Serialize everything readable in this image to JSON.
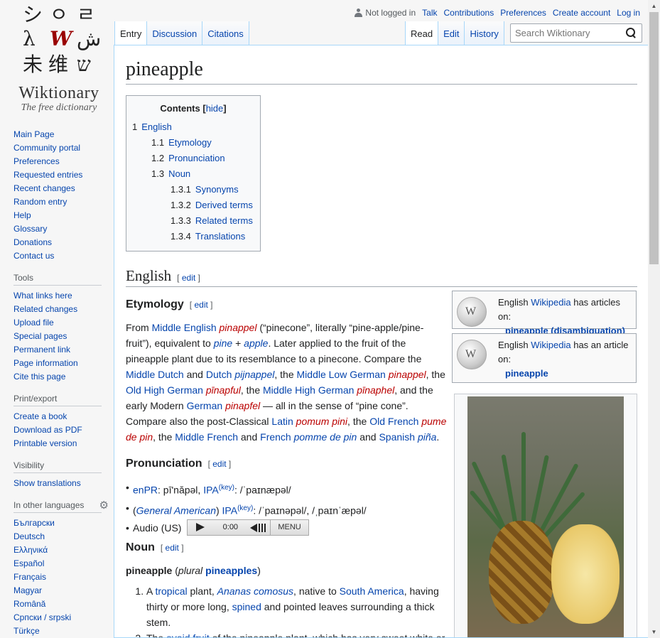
{
  "logo": {
    "glyphs": [
      "シ",
      "ㅇ",
      "ㄹ",
      "λ",
      "W",
      "ش",
      "未",
      "维",
      "ש"
    ],
    "wordmark": "Wiktionary",
    "tagline": "The free dictionary"
  },
  "sidebar": {
    "nav": [
      "Main Page",
      "Community portal",
      "Preferences",
      "Requested entries",
      "Recent changes",
      "Random entry",
      "Help",
      "Glossary",
      "Donations",
      "Contact us"
    ],
    "tools_title": "Tools",
    "tools": [
      "What links here",
      "Related changes",
      "Upload file",
      "Special pages",
      "Permanent link",
      "Page information",
      "Cite this page"
    ],
    "print_title": "Print/export",
    "print": [
      "Create a book",
      "Download as PDF",
      "Printable version"
    ],
    "visibility_title": "Visibility",
    "visibility": [
      "Show translations"
    ],
    "languages_title": "In other languages",
    "languages": [
      "Български",
      "Deutsch",
      "Ελληνικά",
      "Español",
      "Français",
      "Magyar",
      "Română",
      "Српски / srpski",
      "Türkçe"
    ]
  },
  "personal": {
    "not_logged_in": "Not logged in",
    "links": [
      "Talk",
      "Contributions",
      "Preferences",
      "Create account",
      "Log in"
    ]
  },
  "tabs_left": [
    "Entry",
    "Discussion",
    "Citations"
  ],
  "tabs_right": [
    "Read",
    "Edit",
    "History"
  ],
  "search": {
    "placeholder": "Search Wiktionary"
  },
  "page": {
    "title": "pineapple",
    "toc": {
      "title": "Contents",
      "hide": "hide",
      "items": [
        {
          "num": "1",
          "label": "English",
          "level": 1
        },
        {
          "num": "1.1",
          "label": "Etymology",
          "level": 2
        },
        {
          "num": "1.2",
          "label": "Pronunciation",
          "level": 2
        },
        {
          "num": "1.3",
          "label": "Noun",
          "level": 2
        },
        {
          "num": "1.3.1",
          "label": "Synonyms",
          "level": 3
        },
        {
          "num": "1.3.2",
          "label": "Derived terms",
          "level": 3
        },
        {
          "num": "1.3.3",
          "label": "Related terms",
          "level": 3
        },
        {
          "num": "1.3.4",
          "label": "Translations",
          "level": 3
        }
      ]
    },
    "lang_heading": "English",
    "edit": "edit",
    "etymology_heading": "Etymology",
    "pronunciation_heading": "Pronunciation",
    "noun_heading": "Noun",
    "wp1": {
      "prefix": "English ",
      "link": "Wikipedia",
      "suffix": " has articles on:",
      "target": "pineapple (disambiguation)"
    },
    "wp2": {
      "prefix": "English ",
      "link": "Wikipedia",
      "suffix": " has an article on:",
      "target": "pineapple"
    },
    "pron": {
      "enpr_label": "enPR",
      "enpr_value": ": pīʹnăpəl, ",
      "ipa": "IPA",
      "key": "(key)",
      "ipa1": ": /ˈpaɪnæpəl/",
      "ga": "General American",
      "ipa2": ": /ˈpaɪnəpəl/, /ˌpaɪnˈæpəl/",
      "audio_label": "Audio (US)",
      "time": "0:00",
      "menu": "MENU"
    },
    "noun": {
      "headword": "pineapple",
      "plural_label": "plural",
      "plural": "pineapples"
    }
  }
}
